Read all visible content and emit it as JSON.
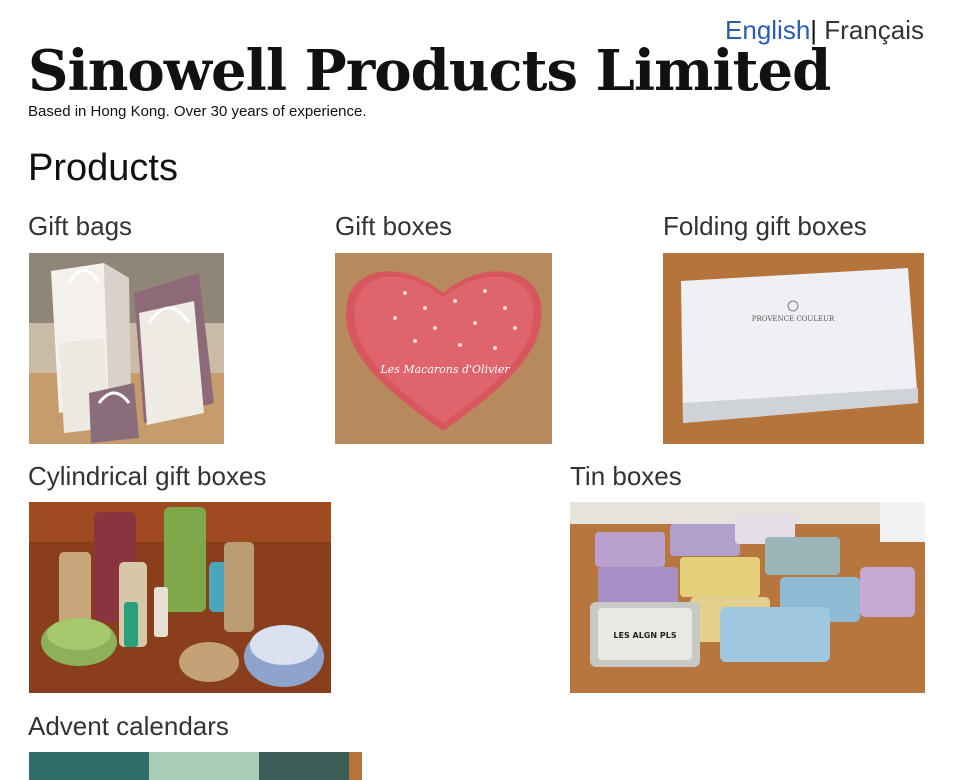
{
  "language": {
    "english": "English",
    "separator": "|",
    "french": "Français"
  },
  "site": {
    "title": "Sinowell Products Limited",
    "tagline": "Based in Hong Kong. Over 30 years of experience."
  },
  "products": {
    "heading": "Products",
    "items": [
      {
        "name": "Gift bags"
      },
      {
        "name": "Gift boxes",
        "image_text": "Les Macarons d'Olivier"
      },
      {
        "name": "Folding gift boxes",
        "image_text": "PROVENCE COULEUR"
      },
      {
        "name": "Cylindrical gift boxes"
      },
      {
        "name": "Tin boxes",
        "image_text": "LES ALGN PLS"
      },
      {
        "name": "Advent calendars"
      }
    ]
  }
}
